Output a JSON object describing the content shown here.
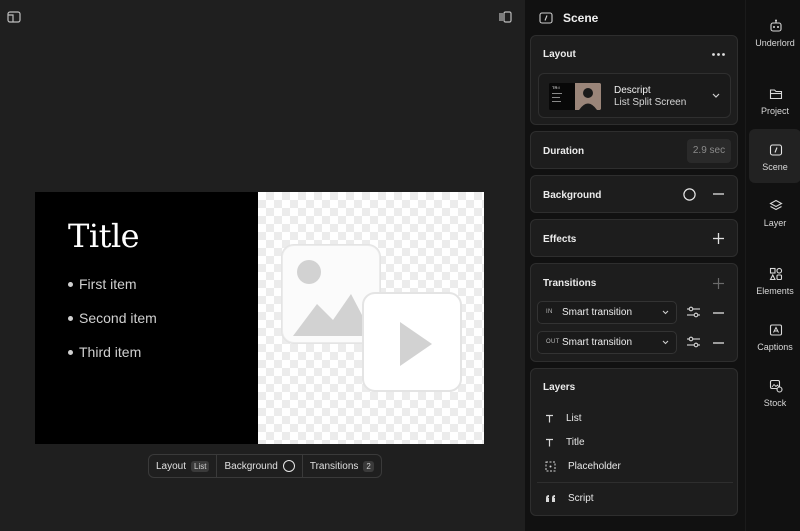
{
  "canvas": {
    "slide": {
      "title": "Title",
      "items": [
        "First item",
        "Second item",
        "Third item"
      ]
    },
    "bottom_bar": {
      "layout_label": "Layout",
      "layout_badge": "List",
      "background_label": "Background",
      "transitions_label": "Transitions",
      "transitions_count": "2"
    }
  },
  "scene_panel": {
    "title": "Scene",
    "layout": {
      "label": "Layout",
      "thumb_text": "TR:I",
      "selected_name": "Descript",
      "selected_sub": "List Split Screen"
    },
    "duration": {
      "label": "Duration",
      "value": "2.9 sec"
    },
    "background": {
      "label": "Background"
    },
    "effects": {
      "label": "Effects"
    },
    "transitions": {
      "label": "Transitions",
      "in_tag": "IN",
      "in_value": "Smart transition",
      "out_tag": "OUT",
      "out_value": "Smart transition"
    },
    "layers": {
      "label": "Layers",
      "items": [
        "List",
        "Title",
        "Placeholder"
      ],
      "script_label": "Script"
    }
  },
  "rail": {
    "items": [
      "Underlord",
      "Project",
      "Scene",
      "Layer",
      "Elements",
      "Captions",
      "Stock"
    ],
    "active": "Scene"
  },
  "colors": {
    "app_bg": "#1e1e1e",
    "panel_bg": "#111111",
    "card_bg": "#1d1d1d",
    "slide_left": "#000000",
    "placeholder_gray": "#d4d4d4"
  }
}
